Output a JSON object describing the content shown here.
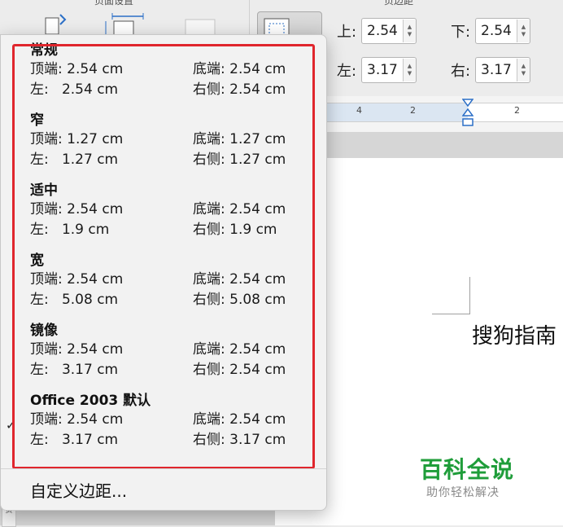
{
  "ribbon": {
    "group_page_setup": "页面设置",
    "group_margins": "页边距",
    "fields": [
      {
        "label": "上:",
        "value": "2.54"
      },
      {
        "label": "下:",
        "value": "2.54"
      },
      {
        "label": "左:",
        "value": "3.17"
      },
      {
        "label": "右:",
        "value": "3.17"
      }
    ]
  },
  "ruler": {
    "numbers": [
      "4",
      "2",
      "2"
    ]
  },
  "margins_menu": {
    "presets": [
      {
        "name": "常规",
        "row1": [
          "顶端: 2.54 cm",
          "底端: 2.54 cm"
        ],
        "row2": [
          "左:   2.54 cm",
          "右侧: 2.54 cm"
        ]
      },
      {
        "name": "窄",
        "row1": [
          "顶端: 1.27 cm",
          "底端: 1.27 cm"
        ],
        "row2": [
          "左:   1.27 cm",
          "右侧: 1.27 cm"
        ]
      },
      {
        "name": "适中",
        "row1": [
          "顶端: 2.54 cm",
          "底端: 2.54 cm"
        ],
        "row2": [
          "左:   1.9 cm",
          "右侧: 1.9 cm"
        ]
      },
      {
        "name": "宽",
        "row1": [
          "顶端: 2.54 cm",
          "底端: 2.54 cm"
        ],
        "row2": [
          "左:   5.08 cm",
          "右侧: 5.08 cm"
        ]
      },
      {
        "name": "镜像",
        "row1": [
          "顶端: 2.54 cm",
          "底端: 2.54 cm"
        ],
        "row2": [
          "左:   3.17 cm",
          "右侧: 2.54 cm"
        ]
      },
      {
        "name": "Office 2003 默认",
        "row1": [
          "顶端: 2.54 cm",
          "底端: 2.54 cm"
        ],
        "row2": [
          "左:   3.17 cm",
          "右侧: 3.17 cm"
        ],
        "selected": true
      }
    ],
    "check_glyph": "✓",
    "custom_label": "自定义边距...",
    "highlight_color": "#e0262d"
  },
  "document": {
    "text": "搜狗指南"
  },
  "watermark": {
    "title": "百科全说",
    "subtitle": "助你轻松解决",
    "color": "#1f9d3a"
  },
  "side_tab": {
    "label": "页"
  }
}
